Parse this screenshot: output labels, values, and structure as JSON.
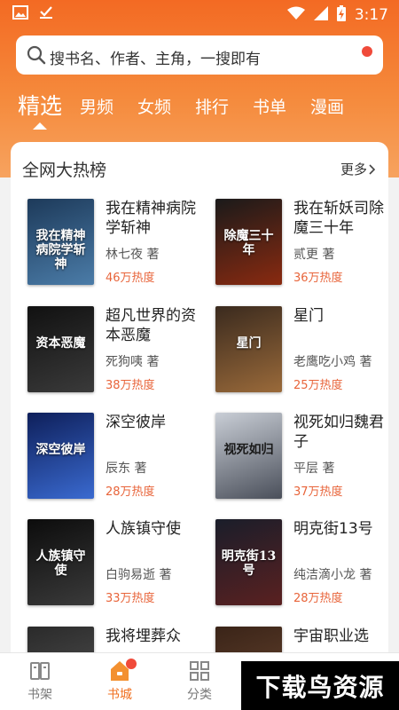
{
  "status": {
    "time": "3:17"
  },
  "search": {
    "placeholder": "搜书名、作者、主角，一搜即有"
  },
  "tabs": [
    {
      "label": "精选",
      "active": true
    },
    {
      "label": "男频"
    },
    {
      "label": "女频"
    },
    {
      "label": "排行"
    },
    {
      "label": "书单"
    },
    {
      "label": "漫画"
    }
  ],
  "section": {
    "title": "全网大热榜",
    "more": "更多"
  },
  "books": [
    {
      "title": "我在精神病院学斩神",
      "author": "林七夜 著",
      "heat": "46万热度",
      "cover_text": "我在精神病院学斩神",
      "colors": [
        "#1d3a5a",
        "#4b7ca8"
      ]
    },
    {
      "title": "我在斩妖司除魔三十年",
      "author": "贰更 著",
      "heat": "36万热度",
      "cover_text": "除魔三十年",
      "colors": [
        "#1a1a1a",
        "#8a2a10"
      ]
    },
    {
      "title": "超凡世界的资本恶魔",
      "author": "死狗咦 著",
      "heat": "38万热度",
      "cover_text": "资本恶魔",
      "colors": [
        "#111111",
        "#3a3a3a"
      ]
    },
    {
      "title": "星门",
      "author": "老鹰吃小鸡 著",
      "heat": "25万热度",
      "cover_text": "星门",
      "colors": [
        "#3a2a1e",
        "#9a6a3a"
      ]
    },
    {
      "title": "深空彼岸",
      "author": "辰东 著",
      "heat": "28万热度",
      "cover_text": "深空彼岸",
      "colors": [
        "#0e1f5a",
        "#3a6ad0"
      ]
    },
    {
      "title": "视死如归魏君子",
      "author": "平层 著",
      "heat": "37万热度",
      "cover_text": "视死如归",
      "colors": [
        "#c9ced6",
        "#4a4f5a"
      ]
    },
    {
      "title": "人族镇守使",
      "author": "白驹易逝 著",
      "heat": "33万热度",
      "cover_text": "人族镇守使",
      "colors": [
        "#0c0c0c",
        "#3a3a3a"
      ]
    },
    {
      "title": "明克街13号",
      "author": "纯洁滴小龙 著",
      "heat": "28万热度",
      "cover_text": "明克街13号",
      "colors": [
        "#1a1e2a",
        "#5a2020"
      ]
    },
    {
      "title": "我将埋葬众",
      "author": "",
      "heat": "",
      "cover_text": "",
      "colors": [
        "#2a2a2a",
        "#555555"
      ]
    },
    {
      "title": "宇宙职业选",
      "author": "",
      "heat": "",
      "cover_text": "",
      "colors": [
        "#3a2418",
        "#6a4630"
      ]
    }
  ],
  "nav": [
    {
      "label": "书架",
      "icon": "bookshelf-icon"
    },
    {
      "label": "书城",
      "icon": "bookstore-icon",
      "active": true,
      "badge": true
    },
    {
      "label": "分类",
      "icon": "category-grid-icon"
    }
  ],
  "watermark": "下载鸟资源",
  "colors": {
    "accent": "#f36a23",
    "heat": "#e8643a",
    "badge": "#f04a3a"
  }
}
